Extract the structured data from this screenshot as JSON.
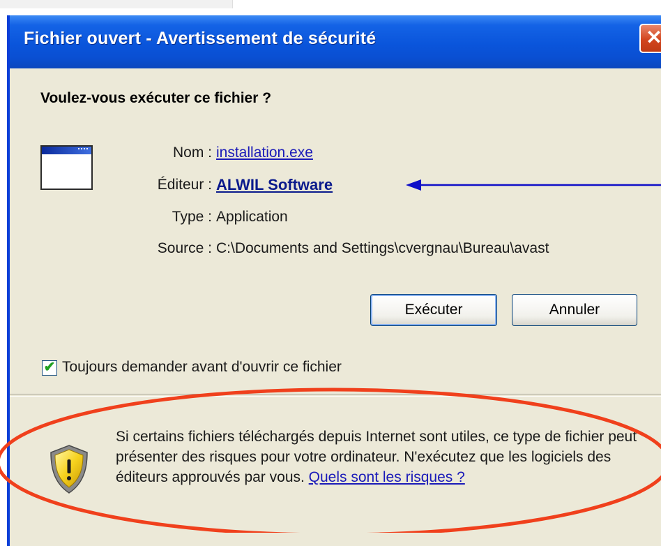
{
  "window": {
    "title": "Fichier ouvert - Avertissement de sécurité",
    "close_glyph": "✕"
  },
  "dialog": {
    "question": "Voulez-vous exécuter ce fichier ?",
    "icon": "application-window-icon",
    "fields": {
      "name_label": "Nom :",
      "name_value": "installation.exe",
      "publisher_label": "Éditeur :",
      "publisher_value": "ALWIL Software",
      "type_label": "Type :",
      "type_value": "Application",
      "source_label": "Source :",
      "source_value": "C:\\Documents and Settings\\cvergnau\\Bureau\\avast"
    },
    "buttons": {
      "run": "Exécuter",
      "cancel": "Annuler"
    },
    "always_ask": {
      "checked": true,
      "glyph": "✔",
      "label": "Toujours demander avant d'ouvrir ce fichier"
    },
    "warning": {
      "icon": "warning-shield-icon",
      "text": "Si certains fichiers téléchargés depuis Internet sont utiles, ce type de fichier peut présenter des risques pour votre ordinateur. N'exécutez que les logiciels des éditeurs approuvés par vous.",
      "link": "Quels sont les risques ?"
    }
  },
  "annotations": {
    "arrow_color": "#1010c8",
    "ellipse_color": "#f0401c"
  },
  "colors": {
    "titlebar": "#0a55db",
    "dialog_bg": "#ece9d8",
    "link": "#1a1ab8"
  }
}
